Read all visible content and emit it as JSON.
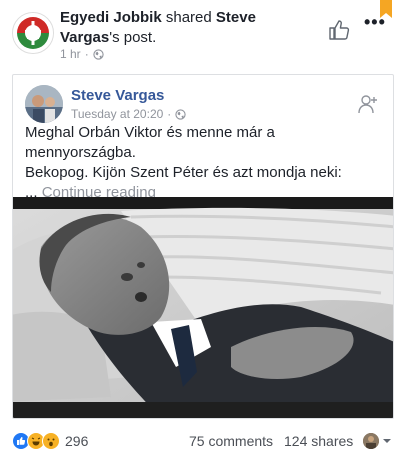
{
  "outer_post": {
    "actor": "Egyedi Jobbik",
    "shared_text": "shared",
    "original_author": "Steve Vargas",
    "suffix": "'s post.",
    "time": "1 hr",
    "dot": "·"
  },
  "shared_post": {
    "author": "Steve Vargas",
    "time": "Tuesday at 20:20",
    "dot": "·",
    "text_line1": "Meghal Orbán Viktor és menne már a mennyországba.",
    "text_line2": "Bekopog. Kijön Szent Péter és azt mondja neki:",
    "ellipsis": "...",
    "continue_label": "Continue reading"
  },
  "footer": {
    "reaction_count": "296",
    "comments": "75 comments",
    "shares": "124 shares"
  },
  "colors": {
    "link": "#365899",
    "secondary": "#90949c",
    "like_blue": "#2078f4",
    "haha_yellow": "#f7b125",
    "bookmark_orange": "#f5a623"
  },
  "icons": [
    "logo-icon",
    "globe-icon",
    "like-page-icon",
    "more-icon",
    "bookmark-icon",
    "add-friend-icon",
    "like-reaction-icon",
    "haha-reaction-icon",
    "wow-reaction-icon",
    "caret-down-icon"
  ]
}
